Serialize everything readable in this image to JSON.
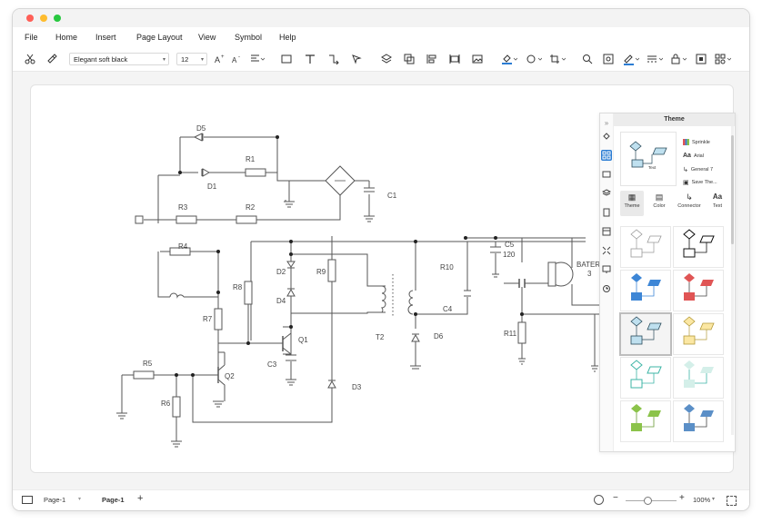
{
  "menu": {
    "file": "File",
    "home": "Home",
    "insert": "Insert",
    "page_layout": "Page Layout",
    "view": "View",
    "symbol": "Symbol",
    "help": "Help"
  },
  "toolbar": {
    "font_name": "Elegant soft black",
    "font_size": "12"
  },
  "diagram": {
    "labels": {
      "d5": "D5",
      "d1": "D1",
      "r1": "R1",
      "r3": "R3",
      "r2": "R2",
      "c1": "C1",
      "r4": "R4",
      "d2": "D2",
      "d4": "D4",
      "r9": "R9",
      "r8": "R8",
      "r7": "R7",
      "q1": "Q1",
      "c3": "C3",
      "t2": "T2",
      "d6": "D6",
      "r10": "R10",
      "c4": "C4",
      "c5": "C5",
      "c5_value": "120",
      "bater": "BATER",
      "bater_num": "3",
      "r11": "R11",
      "r5": "R5",
      "q2": "Q2",
      "r6": "R6",
      "d3": "D3"
    }
  },
  "theme_panel": {
    "title": "Theme",
    "options": {
      "sprinkle": "Sprinkle",
      "arial": "Arial",
      "general": "General 7",
      "save": "Save The..."
    },
    "tabs": {
      "theme": "Theme",
      "color": "Color",
      "connector": "Connector",
      "text": "Text"
    },
    "preview_text": "Text"
  },
  "status": {
    "page_dropdown": "Page-1",
    "page_tab": "Page-1",
    "zoom": "100%"
  },
  "colors": {
    "accent": "#2b7cd3",
    "line": "#555555",
    "swatch_blue": "#3d86d6",
    "swatch_red": "#e05555",
    "swatch_lightblue": "#bfe0ef",
    "swatch_yellow": "#fbe7a3",
    "swatch_teal": "#3db5a6",
    "swatch_green": "#8bc34a"
  }
}
